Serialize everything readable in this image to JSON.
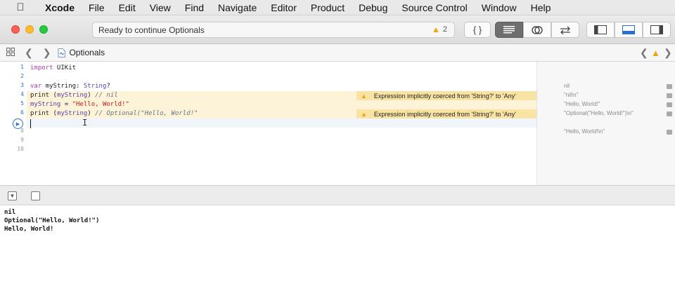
{
  "menubar": {
    "apple_icon": "apple-icon",
    "items": [
      "Xcode",
      "File",
      "Edit",
      "View",
      "Find",
      "Navigate",
      "Editor",
      "Product",
      "Debug",
      "Source Control",
      "Window",
      "Help"
    ]
  },
  "toolbar": {
    "status_text": "Ready to continue Optionals",
    "warning_count": "2",
    "braces_label": "{ }",
    "icons": [
      "lines-icon",
      "overlap-icon",
      "arrows-icon",
      "navigator-icon",
      "debug-area-icon",
      "inspector-icon"
    ]
  },
  "jumpbar": {
    "file_name": "Optionals"
  },
  "editor": {
    "line_numbers": [
      "1",
      "2",
      "3",
      "4",
      "5",
      "6",
      "7",
      "8",
      "9",
      "10"
    ],
    "issue_message": "Expression implicitly coerced from 'String?' to 'Any'",
    "results": [
      "nil",
      "\"nil\\n\"",
      "\"Hello, World!\"",
      "\"Optional(\"Hello, World!\")\\n\"",
      "\"Hello, World!\\n\""
    ]
  },
  "console": {
    "lines": [
      "nil",
      "Optional(\"Hello, World!\")",
      "Hello, World!"
    ]
  },
  "colors": {
    "warning_row": "#fcf3d9",
    "issue_badge": "#f9e3a3",
    "accent": "#2b6fd4"
  }
}
